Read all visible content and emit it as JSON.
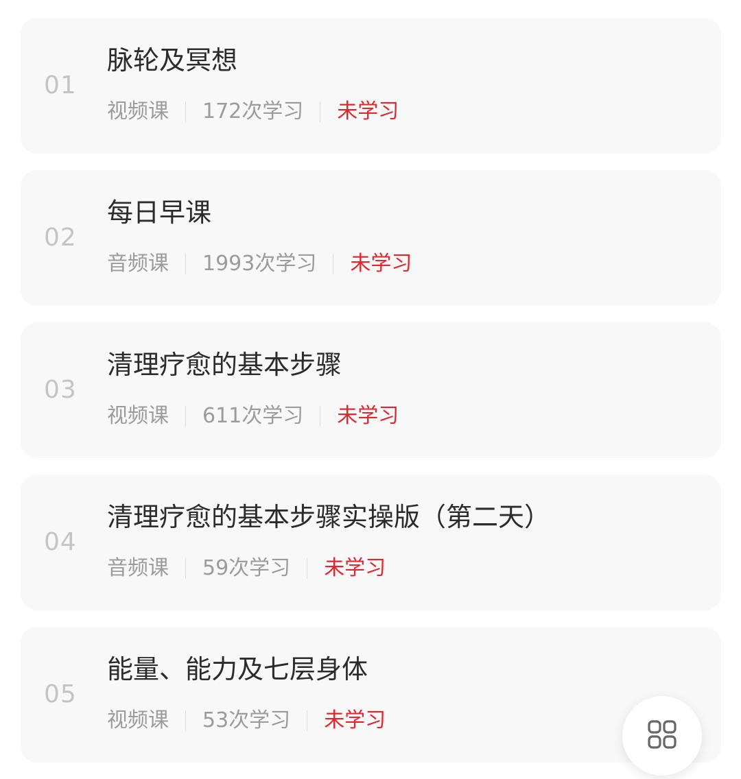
{
  "courses": [
    {
      "num": "01",
      "title": "脉轮及冥想",
      "type": "视频课",
      "count": "172次学习",
      "status": "未学习"
    },
    {
      "num": "02",
      "title": "每日早课",
      "type": "音频课",
      "count": "1993次学习",
      "status": "未学习"
    },
    {
      "num": "03",
      "title": "清理疗愈的基本步骤",
      "type": "视频课",
      "count": "611次学习",
      "status": "未学习"
    },
    {
      "num": "04",
      "title": "清理疗愈的基本步骤实操版（第二天）",
      "type": "音频课",
      "count": "59次学习",
      "status": "未学习"
    },
    {
      "num": "05",
      "title": "能量、能力及七层身体",
      "type": "视频课",
      "count": "53次学习",
      "status": "未学习"
    }
  ],
  "colors": {
    "status": "#e0262f",
    "number": "#c4c4c4",
    "title": "#2b2b2b",
    "meta": "#9b9b9b",
    "card_bg": "#f8f8f8"
  },
  "fab": {
    "icon": "grid-icon"
  }
}
